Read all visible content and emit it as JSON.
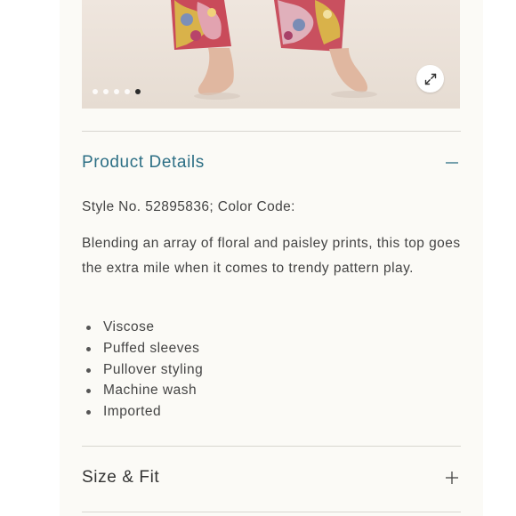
{
  "gallery": {
    "image_alt": "Model wearing floral paisley pants, barefoot",
    "slide_count": 5,
    "active_slide": 5,
    "zoom_icon": "expand-arrows-icon"
  },
  "product_details": {
    "title": "Product Details",
    "toggle_icon": "minus-icon",
    "style_line": "Style No. 52895836; Color Code:",
    "description": "Blending an array of floral and paisley prints, this top goes the extra mile when it comes to trendy pattern play.",
    "features": [
      "Viscose",
      "Puffed sleeves",
      "Pullover styling",
      "Machine wash",
      "Imported"
    ]
  },
  "size_fit": {
    "title": "Size & Fit",
    "toggle_icon": "plus-icon"
  },
  "colors": {
    "accent": "#2d6f85",
    "page_background": "#fbfaf6",
    "divider": "#d8d6d0"
  }
}
